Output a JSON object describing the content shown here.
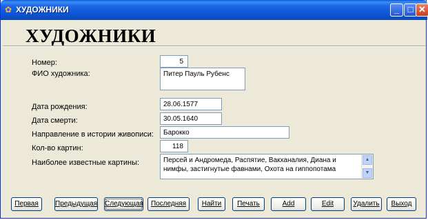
{
  "window": {
    "title": "ХУДОЖНИКИ"
  },
  "form": {
    "heading": "ХУДОЖНИКИ",
    "fields": {
      "number": {
        "label": "Номер:",
        "value": "5"
      },
      "name": {
        "label": "ФИО художника:",
        "value": "Питер Пауль Рубенс"
      },
      "birth": {
        "label": "Дата рождения:",
        "value": "28.06.1577"
      },
      "death": {
        "label": "Дата смерти:",
        "value": "30.05.1640"
      },
      "direction": {
        "label": "Направление в истории живописи:",
        "value": "Барокко"
      },
      "count": {
        "label": "Кол-во картин:",
        "value": "118"
      },
      "famous": {
        "label": "Наиболее известные картины:",
        "value": "Персей и Андромеда, Распятие, Вакханалия, Диана и нимфы, застигнутые фавнами, Охота на гиппопотама"
      }
    }
  },
  "buttons": {
    "first": "Первая",
    "prev": "Предыдущая",
    "next": "Следующая",
    "last": "Последняя",
    "find": "Найти",
    "print": "Печать",
    "add": "Add",
    "edit": "Edit",
    "delete": "Удалить",
    "exit": "Выход"
  }
}
